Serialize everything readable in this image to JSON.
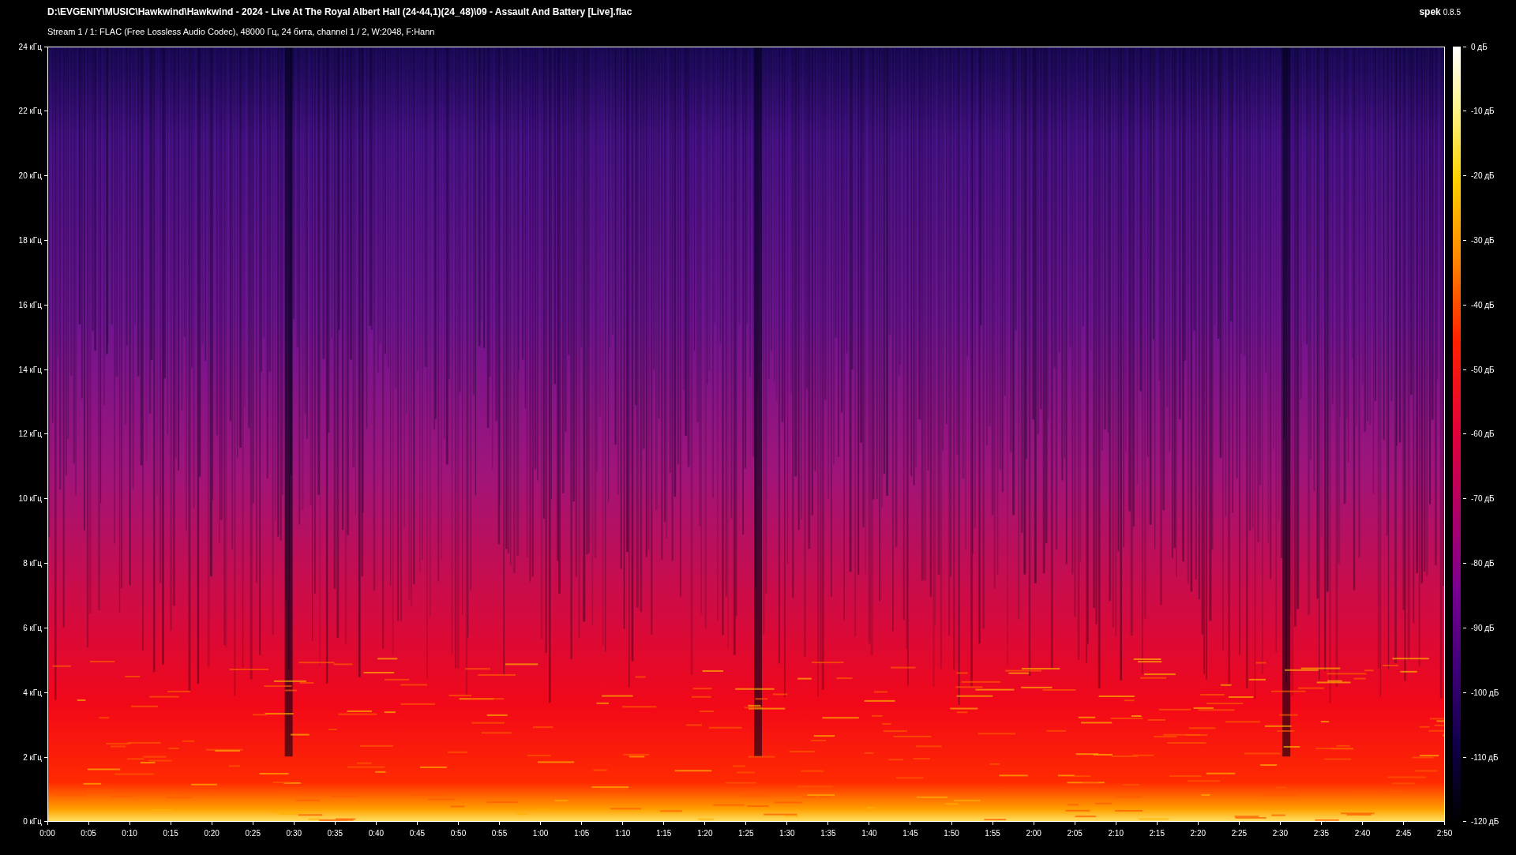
{
  "header": {
    "title": "D:\\EVGENIY\\MUSIC\\Hawkwind\\Hawkwind - 2024 - Live At The Royal Albert Hall (24-44,1)(24_48)\\09 - Assault And Battery [Live].flac",
    "subtitle": "Stream 1 / 1: FLAC (Free Lossless Audio Codec), 48000 Гц, 24 бита, channel 1 / 2, W:2048, F:Hann",
    "app_name": "spek",
    "app_version": "0.8.5"
  },
  "spectrogram": {
    "frequency_labels": [
      "24 кГц",
      "22 кГц",
      "20 кГц",
      "18 кГц",
      "16 кГц",
      "14 кГц",
      "12 кГц",
      "10 кГц",
      "8 кГц",
      "6 кГц",
      "4 кГц",
      "2 кГц",
      "0 кГц"
    ],
    "time_labels": [
      "0:00",
      "0:05",
      "0:10",
      "0:15",
      "0:20",
      "0:25",
      "0:30",
      "0:35",
      "0:40",
      "0:45",
      "0:50",
      "0:55",
      "1:00",
      "1:05",
      "1:10",
      "1:15",
      "1:20",
      "1:25",
      "1:30",
      "1:35",
      "1:40",
      "1:45",
      "1:50",
      "1:55",
      "2:00",
      "2:05",
      "2:10",
      "2:15",
      "2:20",
      "2:25",
      "2:30",
      "2:35",
      "2:40",
      "2:45",
      "2:50"
    ]
  },
  "color_scale": {
    "labels": [
      "0 дБ",
      "-10 дБ",
      "-20 дБ",
      "-30 дБ",
      "-40 дБ",
      "-50 дБ",
      "-60 дБ",
      "-70 дБ",
      "-80 дБ",
      "-90 дБ",
      "-100 дБ",
      "-110 дБ",
      "-120 дБ"
    ]
  }
}
